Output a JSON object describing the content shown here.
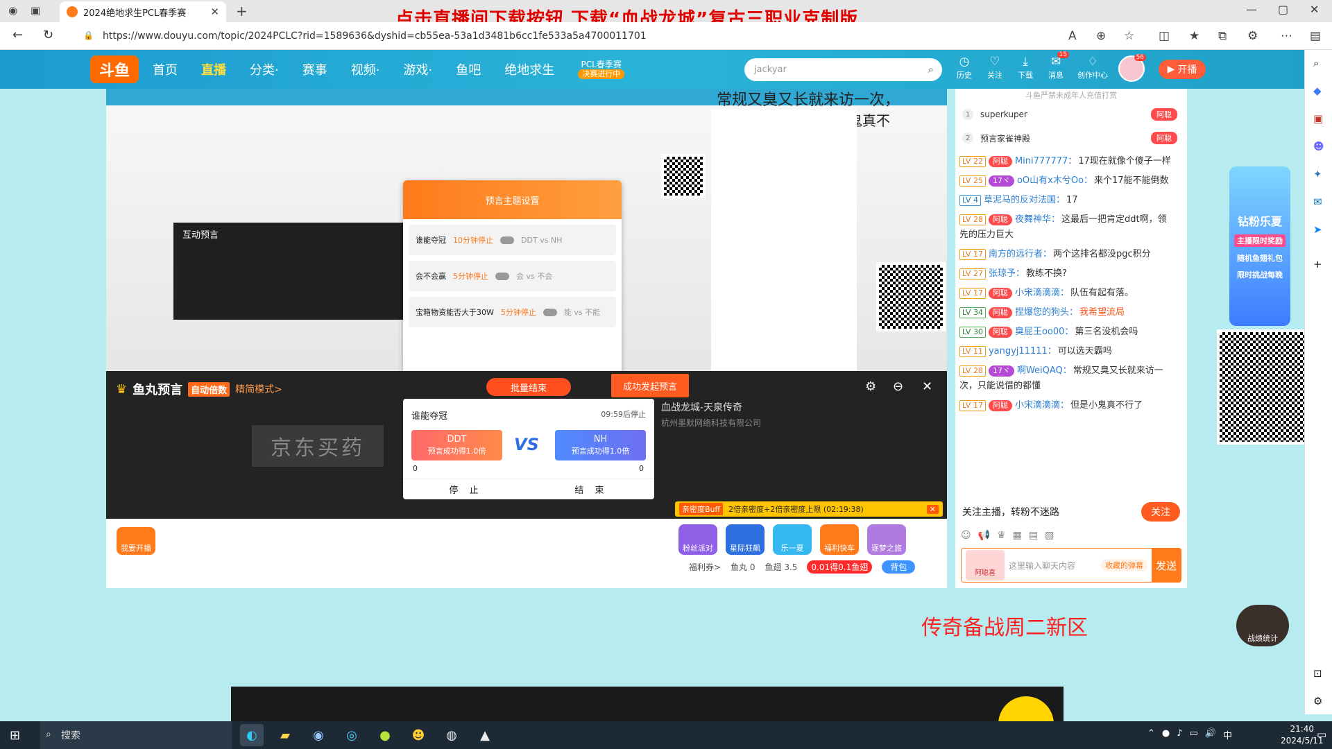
{
  "browser": {
    "tab_title": "2024绝地求生PCL春季赛",
    "url": "https://www.douyu.com/topic/2024PCLC?rid=1589636&dyshid=cb55ea-53a1d3481b6cc1fe533a5a4700011701",
    "overlay_banner": "点击直播间下载按钮  下载“血战龙城”复古三职业克制版"
  },
  "site_nav": {
    "logo_text": "斗鱼",
    "items": [
      "首页",
      "直播",
      "分类·",
      "赛事",
      "视频·",
      "游戏·",
      "鱼吧",
      "绝地求生"
    ],
    "active_item": "直播",
    "pcl_label": "PCL春季赛",
    "pcl_badge": "决赛进行中",
    "search_value": "jackyar",
    "top_icons": [
      {
        "label": "历史",
        "icon": "clock-icon",
        "glyph": "◷"
      },
      {
        "label": "关注",
        "icon": "heart-icon",
        "glyph": "♡"
      },
      {
        "label": "下载",
        "icon": "download-icon",
        "glyph": "⤓"
      },
      {
        "label": "消息",
        "icon": "message-icon",
        "glyph": "✉",
        "badge": "15"
      },
      {
        "label": "创作中心",
        "icon": "bulb-icon",
        "glyph": "♢"
      }
    ],
    "avatar_badge": "56",
    "kaibo_label": "开播"
  },
  "nested_stream": {
    "title_overlay": "常规又臭又长就来访一次，",
    "subtitle_overlay": "但是小鬼真不",
    "panel_title": "互动预言",
    "popup_title": "预言主题设置",
    "popup_rows": [
      {
        "name": "谁能夺冠",
        "sub": "DDT vs NH",
        "tag": "10分钟停止"
      },
      {
        "name": "会不会赢",
        "sub": "会 vs 不会",
        "tag": "5分钟停止"
      },
      {
        "name": "宝箱物资能否大于30W",
        "sub": "能 vs 不能",
        "tag": "5分钟停止"
      }
    ]
  },
  "fish_panel": {
    "title": "鱼丸预言",
    "auto_tag": "自动倍数",
    "simple_mode": "精简模式>",
    "batch_end": "批量结束",
    "start_button": "成功发起预言",
    "game_name": "血战龙城-天泉传奇",
    "company": "杭州墨默网络科技有限公司",
    "ad_text": "京东买药",
    "card": {
      "question": "谁能夺冠",
      "countdown": "09:59后停止",
      "team_a": "DDT",
      "team_a_sub": "预言成功得1.0倍",
      "team_b": "NH",
      "team_b_sub": "预言成功得1.0倍",
      "vs": "VS",
      "score_a": "0",
      "score_b": "0",
      "stop_label": "停 止",
      "end_label": "结 束"
    },
    "buff": {
      "tag": "亲密度Buff",
      "text": "2倍亲密度+2倍亲密度上限 (02:19:38)"
    }
  },
  "below_panel": {
    "kaibo_button": "我要开播",
    "gifts": [
      {
        "label": "粉丝派对",
        "color": "#8f5fe6"
      },
      {
        "label": "星际狂飙",
        "color": "#2e6fe0"
      },
      {
        "label": "乐一夏",
        "color": "#35b8f0"
      },
      {
        "label": "福利快车",
        "color": "#ff7a1a"
      },
      {
        "label": "逐梦之旅",
        "color": "#b07ae0"
      }
    ],
    "welfare": "福利券>",
    "fish_ball": "鱼丸 0",
    "fish_fin": "鱼翅 3.5",
    "recharge": "0.01得0.1鱼翅",
    "backpack": "背包"
  },
  "chat": {
    "top_notice": "斗鱼严禁未成年人充值打赏",
    "ranks": [
      {
        "n": "1",
        "name": "superkuper",
        "fan": "阿聪"
      },
      {
        "n": "2",
        "name": "预言家雀神殿",
        "fan": "阿聪"
      }
    ],
    "messages": [
      {
        "lv": "LV 22",
        "fan": "阿聪",
        "user": "Mini777777：",
        "text": "17现在就像个傻子一样"
      },
      {
        "lv": "LV 25",
        "fan": "17ヾ",
        "user": "oO山有x木兮Oo：",
        "text": "来个17能不能倒数"
      },
      {
        "lv": "LV 4",
        "fan": "",
        "user": "草泥马的反对法国：",
        "text": "17"
      },
      {
        "lv": "LV 28",
        "fan": "阿聪",
        "user": "夜舞神华：",
        "text": "这最后一把肯定ddt啊，领先的压力巨大"
      },
      {
        "lv": "LV 17",
        "fan": "",
        "user": "南方的远行者：",
        "text": "两个这排名都没pgc积分"
      },
      {
        "lv": "LV 27",
        "fan": "",
        "user": "张琼予：",
        "text": "教练不换?"
      },
      {
        "lv": "LV 17",
        "fan": "阿聪",
        "user": "小宋滴滴滴：",
        "text": "队伍有起有落。"
      },
      {
        "lv": "LV 34",
        "fan": "阿聪",
        "user": "捏爆您的狗头：",
        "text": "我希望流局"
      },
      {
        "lv": "LV 30",
        "fan": "阿聪",
        "user": "臭屁王oo00：",
        "text": "第三名没机会吗"
      },
      {
        "lv": "LV 11",
        "fan": "",
        "user": "yangyj11111：",
        "text": "可以选天霸吗"
      },
      {
        "lv": "LV 28",
        "fan": "17ヾ",
        "user": "啊WeiQAQ：",
        "text": "常规又臭又长就来访一次，只能说借的都懂"
      },
      {
        "lv": "LV 17",
        "fan": "阿聪",
        "user": "小宋滴滴滴：",
        "text": "但是小鬼真不行了"
      }
    ],
    "follow_text": "关注主播，转粉不迷路",
    "follow_button": "关注",
    "input_placeholder": "这里输入聊天内容",
    "barrage_tag": "收藏的弹幕",
    "send_button": "发送",
    "badge_label": "阿聪喜"
  },
  "side": {
    "promo_title": "钻粉乐夏",
    "promo_tag": "主播限时奖励",
    "promo_sub": "随机鱼翅礼包",
    "promo_sub2": "限时挑战每晚",
    "chuanqi_text": "传奇备战周二新区",
    "zhanji": "战绩统计"
  },
  "taskbar": {
    "search_label": "搜索",
    "time": "21:40",
    "date": "2024/5/11",
    "ime": "中"
  },
  "colors": {
    "accent": "#ff7a1a",
    "nav_blue": "#2bb4d8",
    "banner_red": "#e00000"
  }
}
